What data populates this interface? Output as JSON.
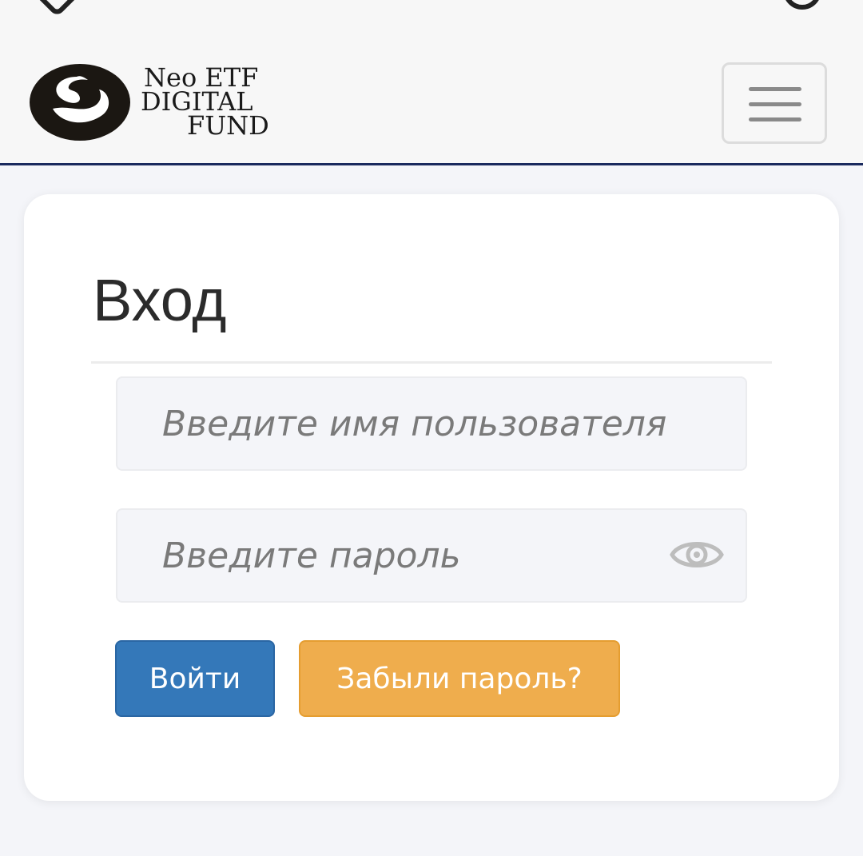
{
  "header": {
    "logo": {
      "line1": "Neo ETF",
      "line2": "DIGITAL",
      "line3": "FUND"
    },
    "menu_icon": "hamburger-icon"
  },
  "login": {
    "title": "Вход",
    "username_placeholder": "Введите имя пользователя",
    "password_placeholder": "Введите пароль",
    "show_password_icon": "eye-icon",
    "login_button": "Войти",
    "forgot_button": "Забыли пароль?"
  },
  "colors": {
    "primary": "#3478b9",
    "warning": "#efad4d",
    "header_border": "#1a2a5e"
  }
}
